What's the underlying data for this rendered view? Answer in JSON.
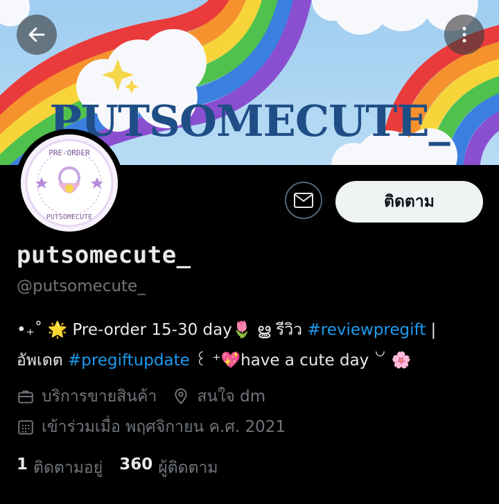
{
  "colors": {
    "background": "#000000",
    "accent": "#1d9bf0",
    "secondary_text": "#71767b",
    "primary_text": "#e7e9ea",
    "follow_button_bg": "#eff3f4"
  },
  "header": {
    "back_icon": "arrow-left-icon",
    "more_icon": "more-vertical-icon",
    "banner_text": "PUTSOMECUTE_"
  },
  "avatar": {
    "ring_text_top": "PRE-ORDER",
    "ring_text_bottom": "PUTSOMECUTE"
  },
  "actions": {
    "message_icon": "envelope-icon",
    "follow_label": "ติดตาม"
  },
  "profile": {
    "display_name": "putsomecute_",
    "handle": "@putsomecute_",
    "bio": {
      "part1": "•₊˚ 🌟 Pre-order 15-30 day🌷 ൠ รีวิว ",
      "tag1": "#reviewpregift",
      "part2": " | อัพเดต ",
      "tag2": "#pregiftupdate",
      "part3": " ꒰ ⁺💖have a cute day ꒡ 🌸"
    },
    "category": "บริการขายสินค้า",
    "category_icon": "briefcase-icon",
    "location": "สนใจ dm",
    "location_icon": "location-pin-icon",
    "joined": "เข้าร่วมเมื่อ พฤศจิกายน ค.ศ. 2021",
    "joined_icon": "calendar-icon"
  },
  "stats": {
    "following_count": "1",
    "following_label": "ติดตามอยู่",
    "followers_count": "360",
    "followers_label": "ผู้ติดตาม"
  }
}
